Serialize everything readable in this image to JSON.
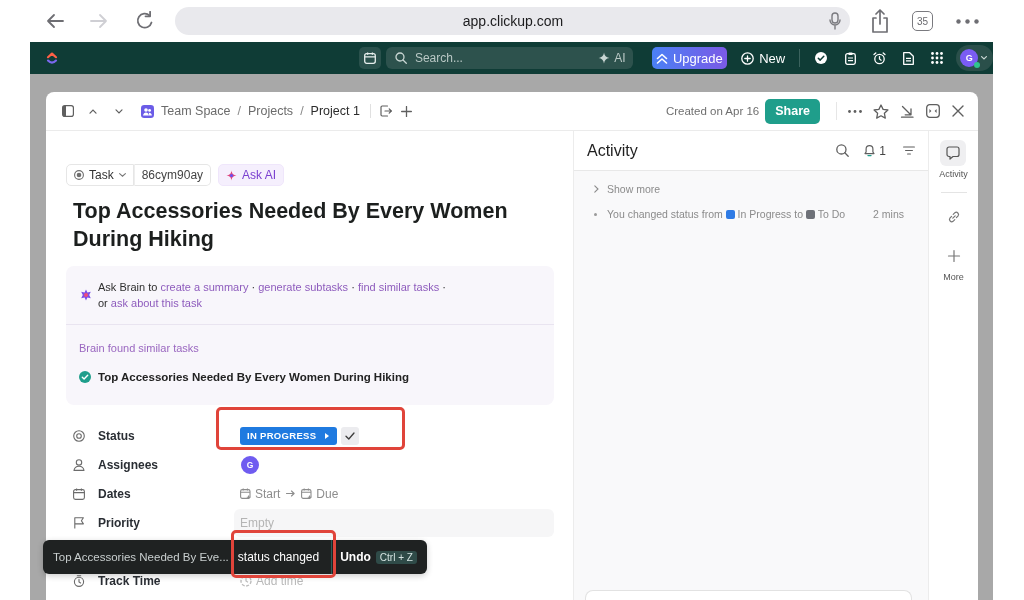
{
  "browser": {
    "nav": [
      {
        "kind": "back",
        "disabled": false
      },
      {
        "kind": "forward",
        "disabled": true
      },
      {
        "kind": "reload",
        "disabled": false
      }
    ],
    "url": "app.clickup.com",
    "tab_count": "35"
  },
  "app_bar": {
    "search": {
      "placeholder": "Search..."
    },
    "ai_button": "AI",
    "upgrade_button": "Upgrade",
    "new_button": "New",
    "account": {
      "initial": "G",
      "online": true
    }
  },
  "task_header": {
    "breadcrumb": [
      {
        "label": "Team Space",
        "current": false
      },
      {
        "separator": "/",
        "label": "Projects",
        "current": false
      },
      {
        "separator": "/",
        "label": "Project 1",
        "current": true
      }
    ],
    "created": "Created on Apr 16",
    "share_button": "Share"
  },
  "task": {
    "type": "Task",
    "id": "86cym90ay",
    "ask_ai_button": "Ask AI",
    "title": "Top Accessories Needed By Every Women During Hiking"
  },
  "brain": {
    "prompt_lines": [
      [
        {
          "kind": "text",
          "text": "Ask Brain to"
        },
        {
          "kind": "link",
          "text": "create a summary"
        },
        {
          "kind": "text",
          "text": "·"
        },
        {
          "kind": "link",
          "text": "generate subtasks"
        },
        {
          "kind": "text",
          "text": "·"
        },
        {
          "kind": "link",
          "text": "find similar tasks"
        },
        {
          "kind": "text",
          "text": "·"
        }
      ],
      [
        {
          "kind": "text",
          "text": "or"
        },
        {
          "kind": "link",
          "text": "ask about this task"
        }
      ]
    ],
    "similar_heading": "Brain found similar tasks",
    "similar_tasks": [
      {
        "title": "Top Accessories Needed By Every Women During Hiking"
      }
    ]
  },
  "properties": [
    {
      "kind": "status",
      "label": "Status",
      "value": "IN PROGRESS",
      "highlighted": true
    },
    {
      "kind": "assignees",
      "label": "Assignees",
      "avatar": "G",
      "highlighted": false
    },
    {
      "kind": "dates",
      "label": "Dates",
      "start": "Start",
      "due": "Due",
      "highlighted": false
    },
    {
      "kind": "priority",
      "label": "Priority",
      "placeholder": "Empty",
      "highlighted": false
    },
    {
      "kind": "time",
      "label": "Track Time",
      "value": "Add time",
      "highlighted": false
    }
  ],
  "toast": {
    "task": "Top Accessories Needed By Eve...",
    "message": "status changed",
    "highlighted": true,
    "action": "Undo",
    "shortcut": "Ctrl + Z"
  },
  "activity": {
    "title": "Activity",
    "unread": "1",
    "show_more": "Show more",
    "events": [
      {
        "lead": "You changed status from",
        "from": {
          "label": "In Progress",
          "color": "#2f7be5"
        },
        "middle": "to",
        "to": {
          "label": "To Do",
          "color": "#6e7178"
        },
        "time": "2 mins"
      }
    ]
  },
  "rail": [
    {
      "kind": "activity",
      "label": "Activity",
      "selected": true
    },
    {
      "kind": "links",
      "selected": false
    },
    {
      "kind": "more",
      "label": "More",
      "selected": false
    }
  ]
}
